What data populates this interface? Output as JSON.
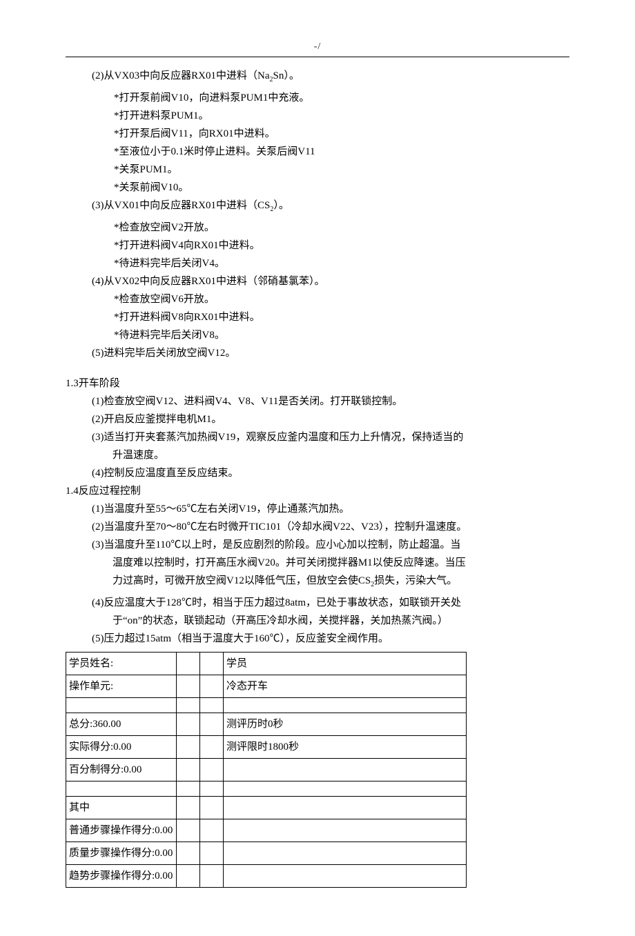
{
  "header": {
    "mark": "-/"
  },
  "sections": {
    "s2": {
      "title_pre": "(2)从VX03中向反应器RX01中进料（Na",
      "title_sub": "2",
      "title_post": "Sn）。",
      "items": [
        "*打开泵前阀V10，向进料泵PUM1中充液。",
        "*打开进料泵PUM1。",
        "*打开泵后阀V11，向RX01中进料。",
        "*至液位小于0.1米时停止进料。关泵后阀V11",
        "*关泵PUM1。",
        "*关泵前阀V10。"
      ]
    },
    "s3": {
      "title_pre": "(3)从VX01中向反应器RX01中进料（CS",
      "title_sub": "2",
      "title_post": "）。",
      "items": [
        "*检查放空阀V2开放。",
        "*打开进料阀V4向RX01中进料。",
        "*待进料完毕后关闭V4。"
      ]
    },
    "s4": {
      "title": "(4)从VX02中向反应器RX01中进料（邻硝基氯苯）。",
      "items": [
        "*检查放空阀V6开放。",
        "*打开进料阀V8向RX01中进料。",
        "*待进料完毕后关闭V8。"
      ]
    },
    "s5": {
      "title": "(5)进料完毕后关闭放空阀V12。"
    },
    "h13": {
      "title": "1.3开车阶段",
      "items": [
        "(1)检查放空阀V12、进料阀V4、V8、V11是否关闭。打开联锁控制。",
        "(2)开启反应釜搅拌电机M1。",
        "(3)适当打开夹套蒸汽加热阀V19，观察反应釜内温度和压力上升情况，保持适当的　　升温速度。",
        "(4)控制反应温度直至反应结束。"
      ]
    },
    "h14": {
      "title": "1.4反应过程控制",
      "i1": "(1)当温度升至55～65℃左右关闭V19，停止通蒸汽加热。",
      "i2": "(2)当温度升至70～80℃左右时微开TIC101（冷却水阀V22、V23），控制升温速度。",
      "i3_pre": "(3)当温度升至110℃以上时，是反应剧烈的阶段。应小心加以控制，防止超温。当温度难以控制时，打开高压水阀V20。并可关闭搅拌器M1以使反应降速。当压力过高时，可微开放空阀V12以降低气压，但放空会使CS",
      "i3_sub": "2",
      "i3_post": "损失，污染大气。",
      "i4": "(4)反应温度大于128℃时，相当于压力超过8atm，已处于事故状态，如联锁开关处于“on”的状态，联锁起动（开高压冷却水阀，关搅拌器，关加热蒸汽阀。）",
      "i5": "(5)压力超过15atm（相当于温度大于160℃），反应釜安全阀作用。"
    }
  },
  "table": {
    "r1": {
      "a": "学员姓名:",
      "d": "学员"
    },
    "r2": {
      "a": "操作单元:",
      "d": "冷态开车"
    },
    "r3": {
      "a": "",
      "d": ""
    },
    "r4": {
      "a": "总分:360.00",
      "d": "测评历时0秒"
    },
    "r5": {
      "a": "实际得分:0.00",
      "d": "测评限时1800秒"
    },
    "r6": {
      "a": "百分制得分:0.00",
      "d": ""
    },
    "r7": {
      "a": "",
      "d": ""
    },
    "r8": {
      "a": "其中",
      "d": ""
    },
    "r9": {
      "a": "普通步骤操作得分:0.00",
      "d": ""
    },
    "r10": {
      "a": "质量步骤操作得分:0.00",
      "d": ""
    },
    "r11": {
      "a": "趋势步骤操作得分:0.00",
      "d": ""
    }
  }
}
